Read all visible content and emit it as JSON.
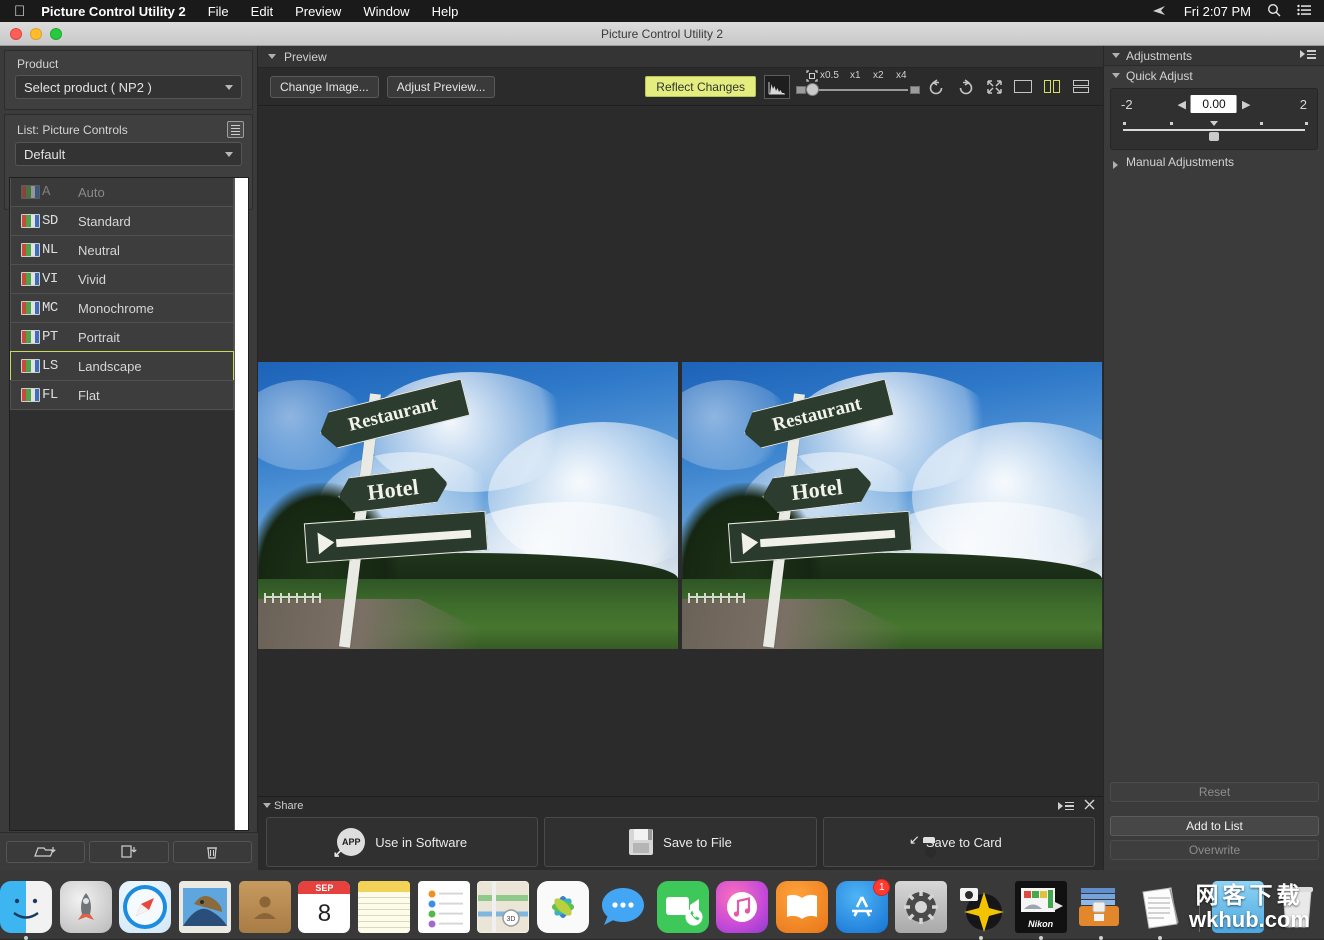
{
  "menubar": {
    "apple_icon": "apple-logo-icon",
    "app_name": "Picture Control Utility 2",
    "menus": [
      "File",
      "Edit",
      "Preview",
      "Window",
      "Help"
    ],
    "clock": "Fri 2:07 PM",
    "right_icons": [
      "airdrop-icon",
      "search-icon",
      "notification-center-icon"
    ]
  },
  "window": {
    "title": "Picture Control Utility 2"
  },
  "sidebar": {
    "product": {
      "label": "Product",
      "selected": "Select product ( NP2 )"
    },
    "list": {
      "label": "List: Picture Controls",
      "header_icon": "list-options-icon",
      "filter_selected": "Default",
      "items": [
        {
          "abbr": "A",
          "name": "Auto",
          "selected": false,
          "disabled": true
        },
        {
          "abbr": "SD",
          "name": "Standard",
          "selected": false,
          "disabled": false
        },
        {
          "abbr": "NL",
          "name": "Neutral",
          "selected": false,
          "disabled": false
        },
        {
          "abbr": "VI",
          "name": "Vivid",
          "selected": false,
          "disabled": false
        },
        {
          "abbr": "MC",
          "name": "Monochrome",
          "selected": false,
          "disabled": false
        },
        {
          "abbr": "PT",
          "name": "Portrait",
          "selected": false,
          "disabled": false
        },
        {
          "abbr": "LS",
          "name": "Landscape",
          "selected": true,
          "disabled": false
        },
        {
          "abbr": "FL",
          "name": "Flat",
          "selected": false,
          "disabled": false
        }
      ]
    },
    "bottom_buttons": [
      {
        "icon": "folder-import-icon"
      },
      {
        "icon": "file-export-icon"
      },
      {
        "icon": "trash-icon"
      }
    ]
  },
  "preview": {
    "section_label": "Preview",
    "change_image_label": "Change Image...",
    "adjust_preview_label": "Adjust Preview...",
    "reflect_changes_label": "Reflect Changes",
    "histogram_icon": "histogram-icon",
    "zoom": {
      "fit_icon": "fit-to-window-icon",
      "ticks": [
        "x0.5",
        "x1",
        "x2",
        "x4"
      ],
      "current": "x0.5"
    },
    "view_icons": [
      {
        "name": "rotate-left-icon",
        "active": false
      },
      {
        "name": "rotate-right-icon",
        "active": false
      },
      {
        "name": "fullscreen-icon",
        "active": false
      },
      {
        "name": "single-view-icon",
        "active": false
      },
      {
        "name": "side-by-side-view-icon",
        "active": true
      },
      {
        "name": "stacked-view-icon",
        "active": false
      }
    ],
    "image": {
      "sign_top": "Restaurant",
      "sign_middle": "Hotel",
      "sign_bottom_icon": "left-arrow-sign"
    }
  },
  "share": {
    "section_label": "Share",
    "menu_icon": "panel-menu-icon",
    "close_icon": "close-icon",
    "buttons": [
      {
        "label": "Use in Software",
        "icon": "app-share-icon"
      },
      {
        "label": "Save to File",
        "icon": "floppy-disk-icon"
      },
      {
        "label": "Save to Card",
        "icon": "camera-card-icon"
      }
    ]
  },
  "adjustments": {
    "header": "Adjustments",
    "header_icon": "panel-menu-icon",
    "quick_adjust": {
      "label": "Quick Adjust",
      "min": "-2",
      "max": "2",
      "value": "0.00",
      "dec_icon": "left-arrow-icon",
      "inc_icon": "right-arrow-icon"
    },
    "manual": {
      "label": "Manual Adjustments",
      "expanded": false
    },
    "buttons": {
      "reset": {
        "label": "Reset",
        "enabled": false
      },
      "add_to_list": {
        "label": "Add to List",
        "enabled": true
      },
      "overwrite": {
        "label": "Overwrite",
        "enabled": false
      }
    }
  },
  "dock": {
    "apps": [
      {
        "name": "finder",
        "running": true
      },
      {
        "name": "launchpad",
        "running": false
      },
      {
        "name": "safari",
        "running": false
      },
      {
        "name": "mail",
        "running": false
      },
      {
        "name": "contacts",
        "running": false
      },
      {
        "name": "calendar",
        "running": false,
        "month": "SEP",
        "day": "8"
      },
      {
        "name": "notes",
        "running": false
      },
      {
        "name": "reminders",
        "running": false
      },
      {
        "name": "maps",
        "running": false
      },
      {
        "name": "photos",
        "running": false
      },
      {
        "name": "messages",
        "running": false
      },
      {
        "name": "facetime",
        "running": false
      },
      {
        "name": "itunes",
        "running": false
      },
      {
        "name": "ibooks",
        "running": false
      },
      {
        "name": "app-store",
        "running": false,
        "badge": "1"
      },
      {
        "name": "system-preferences",
        "running": false
      },
      {
        "name": "capture-nx",
        "running": true
      },
      {
        "name": "nikon-picture-control-utility",
        "running": true
      },
      {
        "name": "archive-utility",
        "running": true
      },
      {
        "name": "text-editor",
        "running": true
      }
    ],
    "trash": "trash-icon"
  },
  "watermark": {
    "cn": "网客下载",
    "en": "wkhub.com"
  }
}
